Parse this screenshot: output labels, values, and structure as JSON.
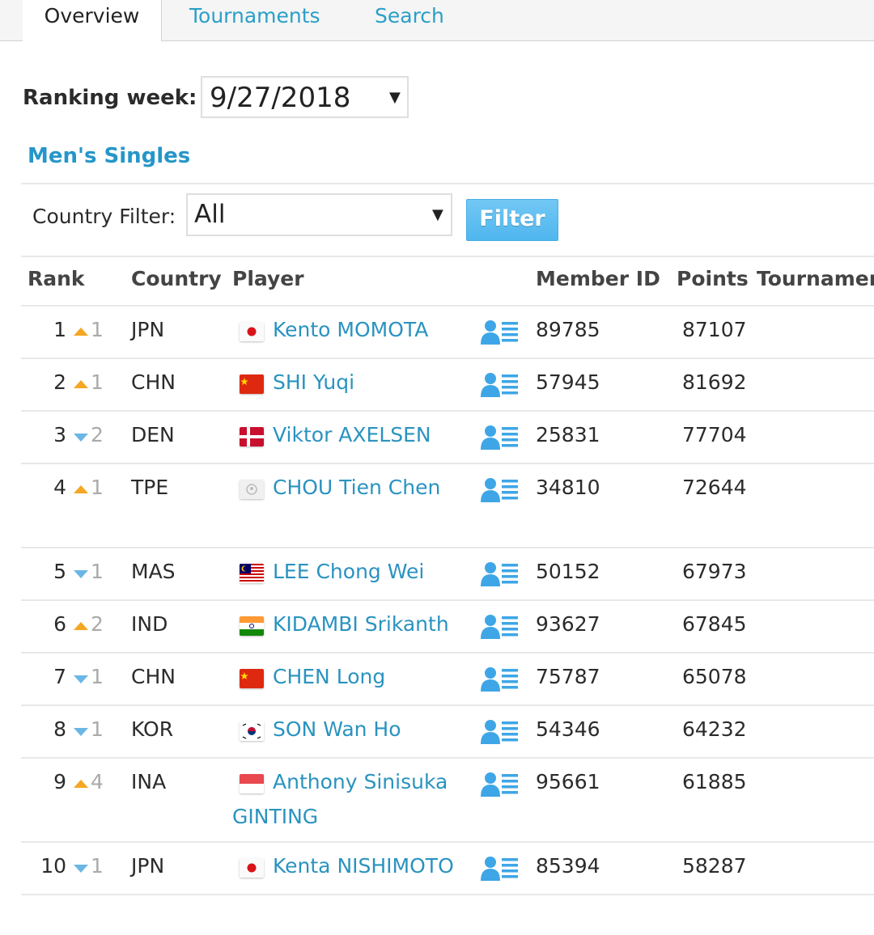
{
  "tabs": [
    {
      "label": "Overview",
      "active": true
    },
    {
      "label": "Tournaments",
      "active": false
    },
    {
      "label": "Search",
      "active": false
    }
  ],
  "ranking_week": {
    "label": "Ranking week:",
    "value": "9/27/2018"
  },
  "section_title": "Men's Singles",
  "country_filter": {
    "label": "Country Filter:",
    "value": "All",
    "button": "Filter"
  },
  "table": {
    "headers": [
      "Rank",
      "Country",
      "Player",
      "Member ID",
      "Points",
      "Tournamen"
    ],
    "rows": [
      {
        "rank": "1",
        "dir": "up",
        "change": "1",
        "country": "JPN",
        "flag": "jpn",
        "player": "Kento MOMOTA",
        "player2": "",
        "member_id": "89785",
        "points": "87107"
      },
      {
        "rank": "2",
        "dir": "up",
        "change": "1",
        "country": "CHN",
        "flag": "chn",
        "player": "SHI Yuqi",
        "player2": "",
        "member_id": "57945",
        "points": "81692"
      },
      {
        "rank": "3",
        "dir": "down",
        "change": "2",
        "country": "DEN",
        "flag": "den",
        "player": "Viktor AXELSEN",
        "player2": "",
        "member_id": "25831",
        "points": "77704"
      },
      {
        "rank": "4",
        "dir": "up",
        "change": "1",
        "country": "TPE",
        "flag": "tpe",
        "player": "CHOU Tien Chen",
        "player2": "",
        "member_id": "34810",
        "points": "72644"
      },
      {
        "rank": "5",
        "dir": "down",
        "change": "1",
        "country": "MAS",
        "flag": "mas",
        "player": "LEE Chong Wei",
        "player2": "",
        "member_id": "50152",
        "points": "67973"
      },
      {
        "rank": "6",
        "dir": "up",
        "change": "2",
        "country": "IND",
        "flag": "ind",
        "player": "KIDAMBI Srikanth",
        "player2": "",
        "member_id": "93627",
        "points": "67845"
      },
      {
        "rank": "7",
        "dir": "down",
        "change": "1",
        "country": "CHN",
        "flag": "chn",
        "player": "CHEN Long",
        "player2": "",
        "member_id": "75787",
        "points": "65078"
      },
      {
        "rank": "8",
        "dir": "down",
        "change": "1",
        "country": "KOR",
        "flag": "kor",
        "player": "SON Wan Ho",
        "player2": "",
        "member_id": "54346",
        "points": "64232"
      },
      {
        "rank": "9",
        "dir": "up",
        "change": "4",
        "country": "INA",
        "flag": "ina",
        "player": "Anthony Sinisuka",
        "player2": "GINTING",
        "member_id": "95661",
        "points": "61885"
      },
      {
        "rank": "10",
        "dir": "down",
        "change": "1",
        "country": "JPN",
        "flag": "jpn",
        "player": "Kenta NISHIMOTO",
        "player2": "",
        "member_id": "85394",
        "points": "58287"
      }
    ]
  },
  "colors": {
    "link": "#2a93c0",
    "up_arrow": "#f5a623",
    "down_arrow": "#6ab7e6",
    "icon": "#3ea6e6",
    "button": "#5bbcf0"
  }
}
